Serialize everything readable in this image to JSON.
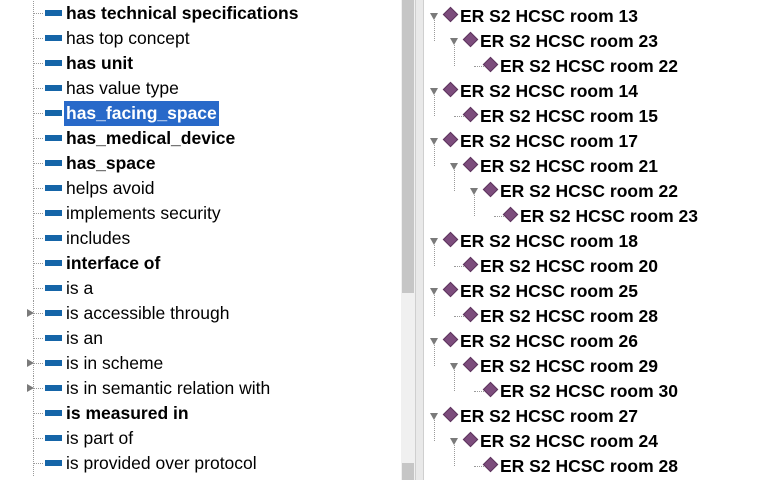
{
  "property_tree": {
    "items": [
      {
        "label": "has technical specifications",
        "bold": true,
        "expandable": false,
        "selected": false
      },
      {
        "label": "has top concept",
        "bold": false,
        "expandable": false,
        "selected": false
      },
      {
        "label": "has unit",
        "bold": true,
        "expandable": false,
        "selected": false
      },
      {
        "label": "has value type",
        "bold": false,
        "expandable": false,
        "selected": false
      },
      {
        "label": "has_facing_space",
        "bold": true,
        "expandable": false,
        "selected": true
      },
      {
        "label": "has_medical_device",
        "bold": true,
        "expandable": false,
        "selected": false
      },
      {
        "label": "has_space",
        "bold": true,
        "expandable": false,
        "selected": false
      },
      {
        "label": "helps avoid",
        "bold": false,
        "expandable": false,
        "selected": false
      },
      {
        "label": "implements security",
        "bold": false,
        "expandable": false,
        "selected": false
      },
      {
        "label": "includes",
        "bold": false,
        "expandable": false,
        "selected": false
      },
      {
        "label": "interface of",
        "bold": true,
        "expandable": false,
        "selected": false
      },
      {
        "label": "is a",
        "bold": false,
        "expandable": false,
        "selected": false
      },
      {
        "label": "is accessible through",
        "bold": false,
        "expandable": true,
        "selected": false
      },
      {
        "label": "is an",
        "bold": false,
        "expandable": false,
        "selected": false
      },
      {
        "label": "is in scheme",
        "bold": false,
        "expandable": true,
        "selected": false
      },
      {
        "label": "is in semantic relation with",
        "bold": false,
        "expandable": true,
        "selected": false
      },
      {
        "label": "is measured in",
        "bold": true,
        "expandable": false,
        "selected": false
      },
      {
        "label": "is part of",
        "bold": false,
        "expandable": false,
        "selected": false
      },
      {
        "label": "is provided over protocol",
        "bold": false,
        "expandable": false,
        "selected": false
      }
    ]
  },
  "instance_tree": {
    "items": [
      {
        "label": "ER S2 HCSC room 13",
        "depth": 0,
        "expanded": true
      },
      {
        "label": "ER S2 HCSC room 23",
        "depth": 1,
        "expanded": true
      },
      {
        "label": "ER S2 HCSC room 22",
        "depth": 2,
        "expanded": false
      },
      {
        "label": "ER S2 HCSC room 14",
        "depth": 0,
        "expanded": true
      },
      {
        "label": "ER S2 HCSC room 15",
        "depth": 1,
        "expanded": false
      },
      {
        "label": "ER S2 HCSC room 17",
        "depth": 0,
        "expanded": true
      },
      {
        "label": "ER S2 HCSC room 21",
        "depth": 1,
        "expanded": true
      },
      {
        "label": "ER S2 HCSC room 22",
        "depth": 2,
        "expanded": true
      },
      {
        "label": "ER S2 HCSC room 23",
        "depth": 3,
        "expanded": false
      },
      {
        "label": "ER S2 HCSC room 18",
        "depth": 0,
        "expanded": true
      },
      {
        "label": "ER S2 HCSC room 20",
        "depth": 1,
        "expanded": false
      },
      {
        "label": "ER S2 HCSC room 25",
        "depth": 0,
        "expanded": true
      },
      {
        "label": "ER S2 HCSC room 28",
        "depth": 1,
        "expanded": false
      },
      {
        "label": "ER S2 HCSC room 26",
        "depth": 0,
        "expanded": true
      },
      {
        "label": "ER S2 HCSC room 29",
        "depth": 1,
        "expanded": true
      },
      {
        "label": "ER S2 HCSC room 30",
        "depth": 2,
        "expanded": false
      },
      {
        "label": "ER S2 HCSC room 27",
        "depth": 0,
        "expanded": true
      },
      {
        "label": "ER S2 HCSC room 24",
        "depth": 1,
        "expanded": true
      },
      {
        "label": "ER S2 HCSC room 28",
        "depth": 2,
        "expanded": false
      }
    ]
  },
  "colors": {
    "property_icon": "#1565a8",
    "instance_icon": "#7c4c7c",
    "selection": "#2869c9"
  }
}
